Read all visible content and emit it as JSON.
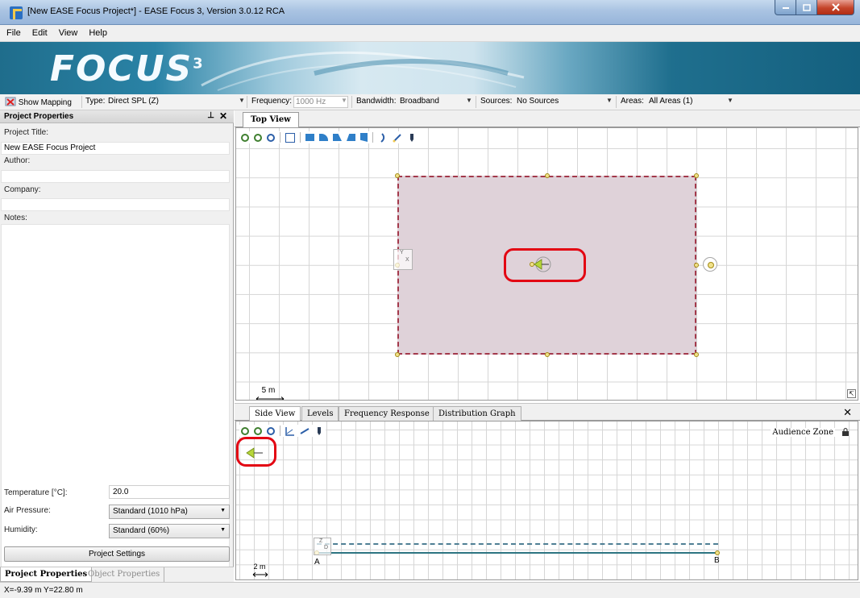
{
  "window": {
    "title": "[New EASE Focus Project*] - EASE Focus 3, Version 3.0.12 RCA"
  },
  "menu": [
    "File",
    "Edit",
    "View",
    "Help"
  ],
  "banner": {
    "logo_text": "FOCUS",
    "logo_version": "3"
  },
  "toolbar": {
    "show_mapping": "Show Mapping",
    "type_label": "Type:",
    "type_value": "Direct SPL (Z)",
    "frequency_label": "Frequency:",
    "frequency_value": "1000 Hz",
    "bandwidth_label": "Bandwidth:",
    "bandwidth_value": "Broadband",
    "sources_label": "Sources:",
    "sources_value": "No Sources",
    "areas_label": "Areas:",
    "areas_value": "All Areas (1)"
  },
  "left_panel": {
    "header": "Project Properties",
    "project_title_label": "Project Title:",
    "project_title_value": "New EASE Focus Project",
    "author_label": "Author:",
    "author_value": "",
    "company_label": "Company:",
    "company_value": "",
    "notes_label": "Notes:",
    "notes_value": "",
    "temperature_label": "Temperature [°C]:",
    "temperature_value": "20.0",
    "air_pressure_label": "Air Pressure:",
    "air_pressure_value": "Standard (1010 hPa)",
    "humidity_label": "Humidity:",
    "humidity_value": "Standard (60%)",
    "settings_button": "Project Settings",
    "tabs": [
      "Project Properties",
      "Object Properties"
    ]
  },
  "top_view": {
    "tab": "Top View",
    "scale": "5 m",
    "axis_y": "Y",
    "axis_x": "X"
  },
  "bottom_tabs": [
    "Side View",
    "Levels",
    "Frequency Response",
    "Distribution Graph"
  ],
  "side_view": {
    "audience_zone": "Audience Zone",
    "scale": "2 m",
    "point_a": "A",
    "point_b": "B",
    "axis_z": "Z",
    "axis_d": "D"
  },
  "status": {
    "coords": "X=-9.39 m Y=22.80 m"
  },
  "colors": {
    "highlight": "#e30613",
    "room_fill": "#dfd2d9",
    "room_border": "#a3394b",
    "source": "#b7d63a"
  }
}
